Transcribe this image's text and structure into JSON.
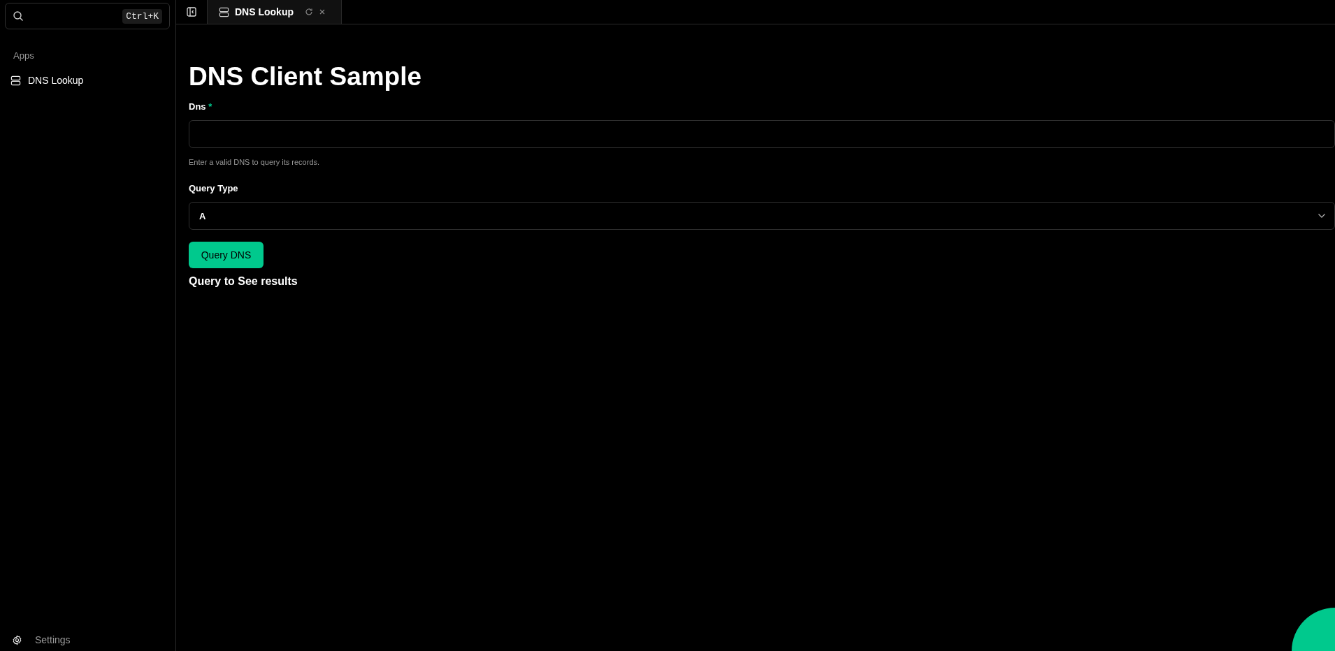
{
  "sidebar": {
    "search": {
      "shortcut": "Ctrl+K"
    },
    "section": "Apps",
    "items": [
      {
        "label": "DNS Lookup",
        "selected": false
      }
    ],
    "settings": "Settings"
  },
  "tabs": [
    {
      "label": "DNS Lookup",
      "selected": true
    }
  ],
  "page": {
    "title": "DNS Client Sample",
    "dns_field": {
      "label": "Dns",
      "required_mark": "*",
      "hint": "Enter a valid DNS to query its records."
    },
    "query_type": {
      "label": "Query Type",
      "value": "A"
    },
    "button": "Query DNS",
    "result": "Query to See results"
  }
}
